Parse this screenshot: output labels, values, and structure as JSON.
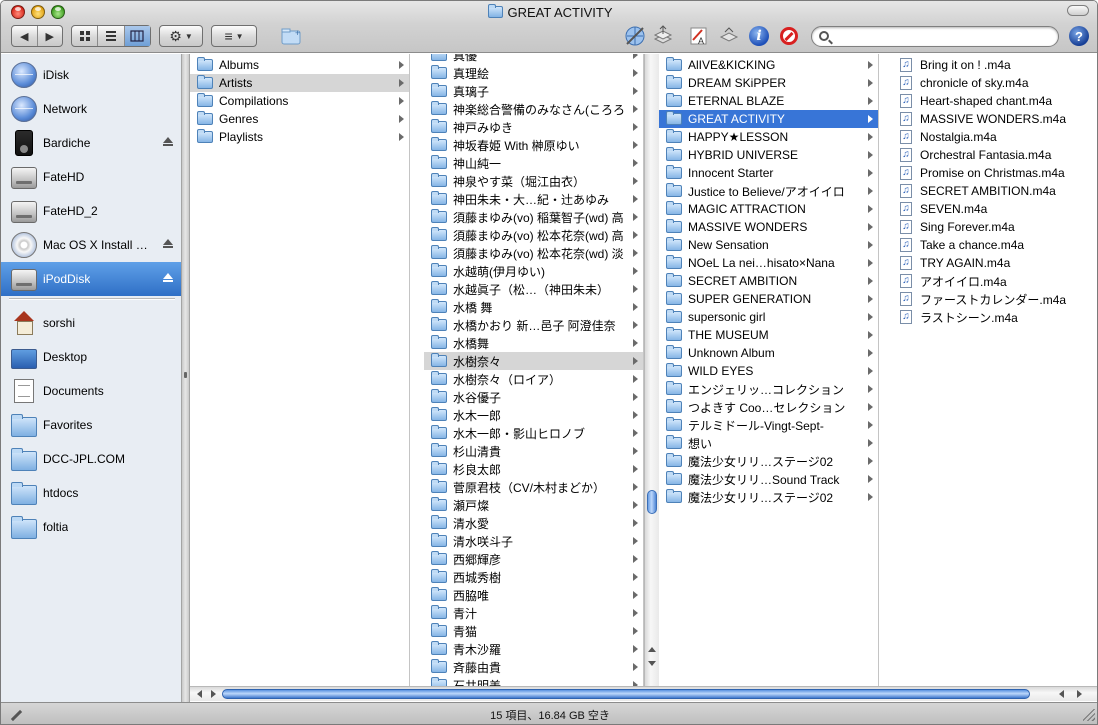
{
  "window": {
    "title": "GREAT ACTIVITY"
  },
  "toolbar": {
    "nav": {
      "back": "◀",
      "forward": "▶"
    },
    "view_modes": [
      "icon-view",
      "list-view",
      "column-view"
    ],
    "action_menu": "⚙",
    "arrange_menu": "≡",
    "search": {
      "value": "",
      "placeholder": ""
    }
  },
  "sidebar": {
    "devices": [
      {
        "label": "iDisk",
        "icon": "idisk-icon",
        "eject": false,
        "selected": false
      },
      {
        "label": "Network",
        "icon": "network-icon",
        "eject": false,
        "selected": false
      },
      {
        "label": "Bardiche",
        "icon": "ipod-icon",
        "eject": true,
        "selected": false
      },
      {
        "label": "FateHD",
        "icon": "hard-disk-icon",
        "eject": false,
        "selected": false
      },
      {
        "label": "FateHD_2",
        "icon": "hard-disk-icon",
        "eject": false,
        "selected": false
      },
      {
        "label": "Mac OS X Install DVD",
        "icon": "dvd-icon",
        "eject": true,
        "selected": false
      },
      {
        "label": "iPodDisk",
        "icon": "ipod-disk-icon",
        "eject": true,
        "selected": true
      }
    ],
    "places": [
      {
        "label": "sorshi",
        "icon": "home-icon"
      },
      {
        "label": "Desktop",
        "icon": "desktop-icon"
      },
      {
        "label": "Documents",
        "icon": "documents-icon"
      },
      {
        "label": "Favorites",
        "icon": "folder-icon"
      },
      {
        "label": "DCC-JPL.COM",
        "icon": "folder-icon"
      },
      {
        "label": "htdocs",
        "icon": "folder-icon"
      },
      {
        "label": "foltia",
        "icon": "folder-icon"
      }
    ]
  },
  "columns": {
    "library": {
      "items": [
        "Albums",
        "Artists",
        "Compilations",
        "Genres",
        "Playlists"
      ],
      "selected": 1
    },
    "artists": {
      "items": [
        "真優",
        "真理絵",
        "真璃子",
        "神楽総合警備のみなさん(ころろ",
        "神戸みゆき",
        "神坂春姫 With 榊原ゆい",
        "神山純一",
        "神泉やす菜（堀江由衣）",
        "神田朱未・大…紀・辻あゆみ",
        "須藤まゆみ(vo) 稲葉智子(wd) 高",
        "須藤まゆみ(vo) 松本花奈(wd) 高",
        "須藤まゆみ(vo) 松本花奈(wd) 淡",
        "水越萌(伊月ゆい)",
        "水越眞子（松…（神田朱未）",
        "水橋 舞",
        "水橋かおり 新…邑子 阿澄佳奈",
        "水橋舞",
        "水樹奈々",
        "水樹奈々（ロイア）",
        "水谷優子",
        "水木一郎",
        "水木一郎・影山ヒロノブ",
        "杉山清貴",
        "杉良太郎",
        "菅原君枝（CV/木村まどか）",
        "瀬戸燦",
        "清水愛",
        "清水咲斗子",
        "西郷輝彦",
        "西城秀樹",
        "西脇唯",
        "青汁",
        "青猫",
        "青木沙羅",
        "斉藤由貴",
        "石井明美"
      ],
      "selected": 17
    },
    "albums": {
      "items": [
        "AlIVE&KICKING",
        "DREAM SKiPPER",
        "ETERNAL BLAZE",
        "GREAT ACTIVITY",
        "HAPPY★LESSON",
        "HYBRID UNIVERSE",
        "Innocent Starter",
        "Justice to Believe/アオイイロ",
        "MAGIC ATTRACTION",
        "MASSIVE WONDERS",
        "New Sensation",
        "NOeL La nei…hisato×Nana",
        "SECRET AMBITION",
        "SUPER GENERATION",
        "supersonic girl",
        "THE MUSEUM",
        "Unknown Album",
        "WILD EYES",
        "エンジェリッ…コレクション",
        "つよきす Coo…セレクション",
        "テルミドール-Vingt-Sept-",
        "想い",
        "魔法少女リリ…ステージ02",
        "魔法少女リリ…Sound Track",
        "魔法少女リリ…ステージ02"
      ],
      "selected": 3
    },
    "tracks": {
      "items": [
        "Bring it on ! .m4a",
        "chronicle of sky.m4a",
        "Heart-shaped chant.m4a",
        "MASSIVE WONDERS.m4a",
        "Nostalgia.m4a",
        "Orchestral Fantasia.m4a",
        "Promise on Christmas.m4a",
        "SECRET AMBITION.m4a",
        "SEVEN.m4a",
        "Sing Forever.m4a",
        "Take a chance.m4a",
        "TRY AGAIN.m4a",
        "アオイイロ.m4a",
        "ファーストカレンダー.m4a",
        "ラストシーン.m4a"
      ]
    }
  },
  "status": {
    "text": "15 項目、16.84 GB 空き"
  },
  "colors": {
    "selection": "#3875d7",
    "sidebar_selection": "#2f6fc6",
    "inactive_selection": "#d6d6d6"
  }
}
